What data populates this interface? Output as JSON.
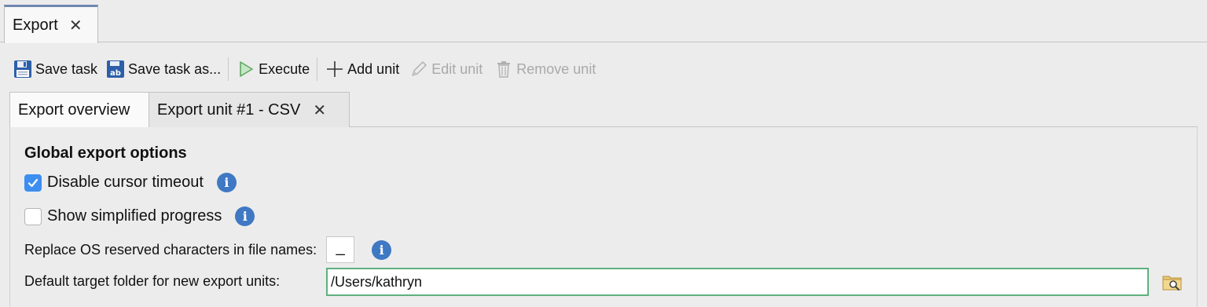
{
  "top_tab": {
    "label": "Export",
    "close": "✕"
  },
  "toolbar": {
    "save_task": "Save task",
    "save_task_as": "Save task as...",
    "execute": "Execute",
    "add_unit": "Add unit",
    "edit_unit": "Edit unit",
    "remove_unit": "Remove unit",
    "save_as_icon_text": "ab",
    "icons": {
      "save": "floppy-disk-icon",
      "save_as": "floppy-disk-ab-icon",
      "execute": "play-icon",
      "add": "plus-icon",
      "edit": "pencil-icon",
      "remove": "trash-icon"
    }
  },
  "inner_tabs": [
    {
      "label": "Export overview",
      "active": true
    },
    {
      "label": "Export unit #1 - CSV",
      "active": false,
      "close": "✕"
    }
  ],
  "panel": {
    "title": "Global export options",
    "disable_cursor_timeout": {
      "label": "Disable cursor timeout",
      "checked": true
    },
    "show_simplified_progress": {
      "label": "Show simplified progress",
      "checked": false
    },
    "replace_chars": {
      "label": "Replace OS reserved characters in file names:",
      "value": "_"
    },
    "target_folder": {
      "label": "Default target folder for new export units:",
      "value": "/Users/kathryn"
    },
    "info_glyph": "i",
    "check_glyph": "✓"
  },
  "colors": {
    "accent_tab": "#6f86b0",
    "checkbox": "#3d8ef0",
    "info": "#3f78c3",
    "focus_border": "#5fb07e",
    "save_icon": "#2d5fa8",
    "execute_icon": "#5ea85e"
  }
}
